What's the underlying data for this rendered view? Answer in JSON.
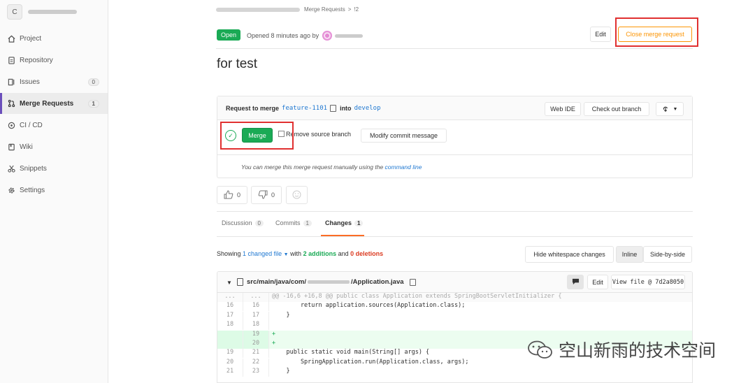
{
  "sidebar": {
    "avatar_letter": "C",
    "items": [
      {
        "label": "Project",
        "icon": "home-icon"
      },
      {
        "label": "Repository",
        "icon": "doc-icon"
      },
      {
        "label": "Issues",
        "icon": "issues-icon",
        "count": "0"
      },
      {
        "label": "Merge Requests",
        "icon": "merge-request-icon",
        "count": "1",
        "active": true
      },
      {
        "label": "CI / CD",
        "icon": "rocket-icon"
      },
      {
        "label": "Wiki",
        "icon": "book-icon"
      },
      {
        "label": "Snippets",
        "icon": "scissors-icon"
      },
      {
        "label": "Settings",
        "icon": "gear-icon"
      }
    ]
  },
  "breadcrumb": {
    "section": "Merge Requests",
    "separator": ">",
    "current": "!2"
  },
  "header": {
    "status": "Open",
    "opened_text": "Opened 8 minutes ago by",
    "edit_label": "Edit",
    "close_label": "Close merge request"
  },
  "title": "for test",
  "widget": {
    "request_prefix": "Request to merge",
    "source_branch": "feature-1101",
    "into_text": "into",
    "target_branch": "develop",
    "web_ide_label": "Web IDE",
    "checkout_label": "Check out branch",
    "merge_label": "Merge",
    "remove_source_label": "Remove source branch",
    "modify_commit_label": "Modify commit message",
    "manual_text": "You can merge this merge request manually using the",
    "manual_link": "command line"
  },
  "awards": {
    "thumbs_up": "0",
    "thumbs_down": "0"
  },
  "tabs": [
    {
      "label": "Discussion",
      "count": "0"
    },
    {
      "label": "Commits",
      "count": "1"
    },
    {
      "label": "Changes",
      "count": "1"
    }
  ],
  "changes": {
    "showing_prefix": "Showing",
    "changed_files": "1 changed file",
    "with_text": "with",
    "additions": "2 additions",
    "and_text": "and",
    "deletions": "0 deletions",
    "hide_ws_label": "Hide whitespace changes",
    "inline_label": "Inline",
    "side_by_side_label": "Side-by-side"
  },
  "file": {
    "path_prefix": "src/main/java/com/",
    "path_suffix": "/Application.java",
    "edit_label": "Edit",
    "view_file_label": "View file @ 7d2a8050",
    "lines": [
      {
        "old": "...",
        "new": "...",
        "code": "@@ -16,6 +16,8 @@ public class Application extends SpringBootServletInitializer {",
        "type": "meta"
      },
      {
        "old": "16",
        "new": "16",
        "code": "        return application.sources(Application.class);",
        "type": "ctx"
      },
      {
        "old": "17",
        "new": "17",
        "code": "    }",
        "type": "ctx"
      },
      {
        "old": "18",
        "new": "18",
        "code": "",
        "type": "ctx"
      },
      {
        "old": "",
        "new": "19",
        "code": "+",
        "type": "add"
      },
      {
        "old": "",
        "new": "20",
        "code": "+",
        "type": "add"
      },
      {
        "old": "19",
        "new": "21",
        "code": "    public static void main(String[] args) {",
        "type": "ctx"
      },
      {
        "old": "20",
        "new": "22",
        "code": "        SpringApplication.run(Application.class, args);",
        "type": "ctx"
      },
      {
        "old": "21",
        "new": "23",
        "code": "    }",
        "type": "ctx"
      }
    ]
  },
  "watermark": "空山新雨的技术空间"
}
